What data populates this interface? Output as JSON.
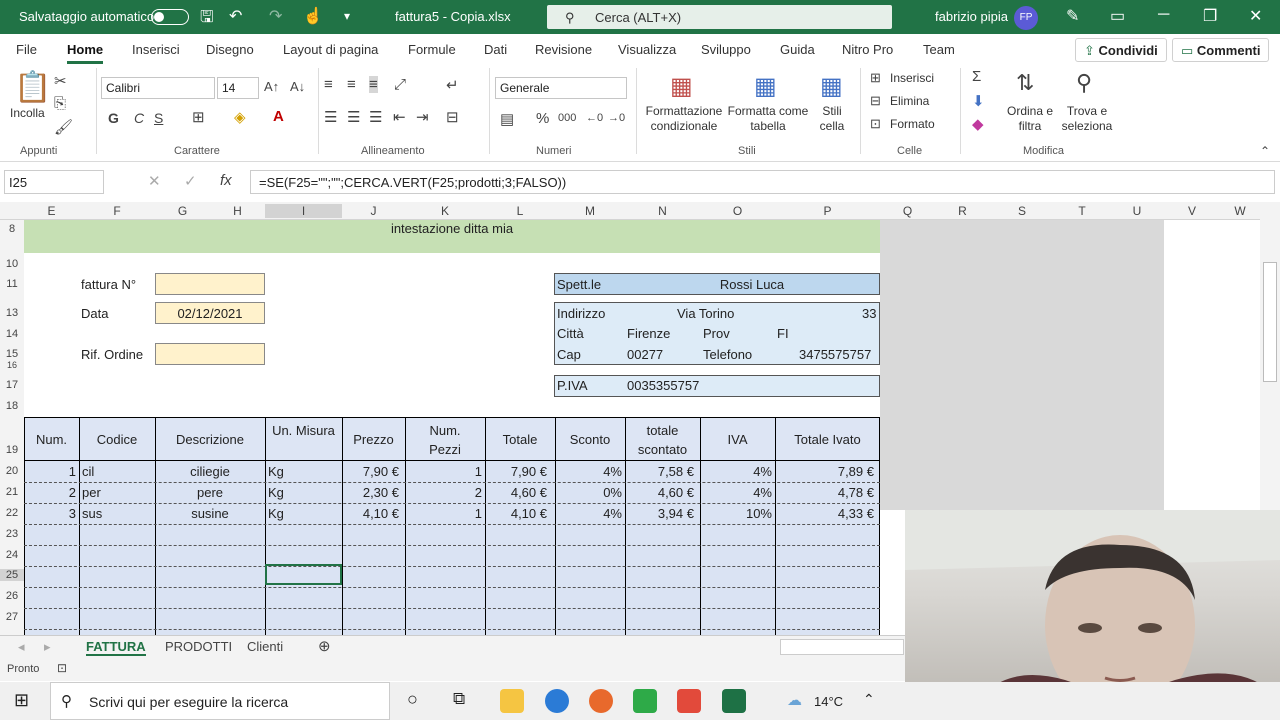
{
  "titlebar": {
    "autosave": "Salvataggio automatico",
    "filename": "fattura5 - Copia.xlsx",
    "search": "Cerca (ALT+X)",
    "user": "fabrizio pipia",
    "initials": "FP"
  },
  "menu": [
    "File",
    "Home",
    "Inserisci",
    "Disegno",
    "Layout di pagina",
    "Formule",
    "Dati",
    "Revisione",
    "Visualizza",
    "Sviluppo",
    "Guida",
    "Nitro Pro",
    "Team"
  ],
  "share": "Condividi",
  "comments": "Commenti",
  "ribbon": {
    "paste": "Incolla",
    "font": "Calibri",
    "size": "14",
    "bold": "G",
    "italic": "C",
    "underline": "S",
    "numformat": "Generale",
    "condfmt": "Formattazione condizionale",
    "tablefmt": "Formatta come tabella",
    "cellstyles": "Stili cella",
    "insert": "Inserisci",
    "delete": "Elimina",
    "format": "Formato",
    "sortfilter": "Ordina e filtra",
    "findselect": "Trova e seleziona",
    "groups": [
      "Appunti",
      "Carattere",
      "Allineamento",
      "Numeri",
      "Stili",
      "Celle",
      "Modifica"
    ]
  },
  "namebox": "I25",
  "formula": "=SE(F25=\"\";\"\";CERCA.VERT(F25;prodotti;3;FALSO))",
  "columns": [
    "E",
    "F",
    "G",
    "H",
    "I",
    "J",
    "K",
    "L",
    "M",
    "N",
    "O",
    "P",
    "Q",
    "R",
    "S",
    "T",
    "U",
    "V",
    "W"
  ],
  "rows": [
    "8",
    "10",
    "11",
    "13",
    "14",
    "15",
    "16",
    "17",
    "18",
    "19",
    "20",
    "21",
    "22",
    "23",
    "24",
    "25",
    "26",
    "27"
  ],
  "sheet": {
    "banner": "intestazione ditta mia",
    "fattura_label": "fattura N°",
    "data_label": "Data",
    "data_value": "02/12/2021",
    "rif_label": "Rif. Ordine",
    "spett": "Spett.le",
    "cliente": "Rossi Luca",
    "indirizzo": "Indirizzo",
    "via": "Via Torino",
    "civico": "33",
    "citta": "Città",
    "citta_v": "Firenze",
    "prov": "Prov",
    "prov_v": "FI",
    "cap": "Cap",
    "cap_v": "00277",
    "telefono": "Telefono",
    "telefono_v": "3475575757",
    "piva": "P.IVA",
    "piva_v": "0035355757"
  },
  "table": {
    "headers": [
      "Num.",
      "Codice",
      "Descrizione",
      "Un. Misura",
      "Prezzo",
      "Num. Pezzi",
      "Totale",
      "Sconto",
      "totale scontato",
      "IVA",
      "Totale Ivato"
    ],
    "rows": [
      [
        "1",
        "cil",
        "ciliegie",
        "Kg",
        "7,90 €",
        "1",
        "7,90 €",
        "4%",
        "7,58 €",
        "4%",
        "7,89 €"
      ],
      [
        "2",
        "per",
        "pere",
        "Kg",
        "2,30 €",
        "2",
        "4,60 €",
        "0%",
        "4,60 €",
        "4%",
        "4,78 €"
      ],
      [
        "3",
        "sus",
        "susine",
        "Kg",
        "4,10 €",
        "1",
        "4,10 €",
        "4%",
        "3,94 €",
        "10%",
        "4,33 €"
      ]
    ]
  },
  "tabs": [
    "FATTURA",
    "PRODOTTI",
    "Clienti"
  ],
  "status": "Pronto",
  "taskbar": {
    "search": "Scrivi qui per eseguire la ricerca",
    "temp": "14°C"
  }
}
